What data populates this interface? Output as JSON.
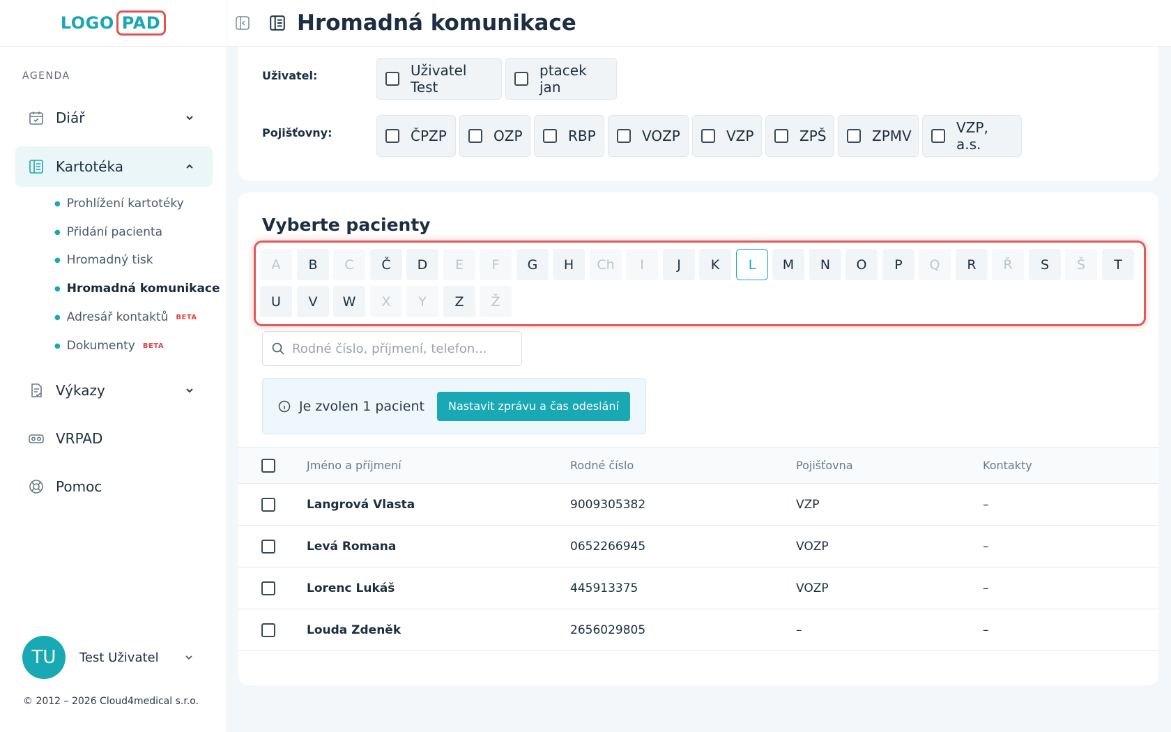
{
  "app": {
    "logo_left": "LOGO",
    "logo_right": "PAD",
    "page_title": "Hromadná komunikace"
  },
  "sidebar": {
    "section_label": "AGENDA",
    "nav": [
      {
        "label": "Diář"
      },
      {
        "label": "Kartotéka"
      },
      {
        "label": "Výkazy"
      },
      {
        "label": "VRPAD"
      },
      {
        "label": "Pomoc"
      }
    ],
    "sub_items": [
      {
        "label": "Prohlížení kartotéky"
      },
      {
        "label": "Přidání pacienta"
      },
      {
        "label": "Hromadný tisk"
      },
      {
        "label": "Hromadná komunikace"
      },
      {
        "label": "Adresář kontaktů",
        "badge": "BETA"
      },
      {
        "label": "Dokumenty",
        "badge": "BETA"
      }
    ],
    "user": {
      "initials": "TU",
      "name": "Test Uživatel"
    },
    "copyright": "© 2012 – 2026 Cloud4medical s.r.o."
  },
  "filters": {
    "users_label": "Uživatel:",
    "users": [
      "Uživatel Test",
      "ptacek jan"
    ],
    "insurers_label": "Pojišťovny:",
    "insurers": [
      "ČPZP",
      "OZP",
      "RBP",
      "VOZP",
      "VZP",
      "ZPŠ",
      "ZPMV",
      "VZP, a.s."
    ]
  },
  "patients": {
    "title": "Vyberte pacienty",
    "letters": [
      "A",
      "B",
      "C",
      "Č",
      "D",
      "E",
      "F",
      "G",
      "H",
      "Ch",
      "I",
      "J",
      "K",
      "L",
      "M",
      "N",
      "O",
      "P",
      "Q",
      "R",
      "Ř",
      "S",
      "Š",
      "T",
      "U",
      "V",
      "W",
      "X",
      "Y",
      "Z",
      "Ž"
    ],
    "search_placeholder": "Rodné číslo, příjmení, telefon...",
    "info_text": "Je zvolen 1 pacient",
    "action_button": "Nastavit zprávu a čas odeslání",
    "columns": [
      "Jméno a příjmení",
      "Rodné číslo",
      "Pojišťovna",
      "Kontakty"
    ],
    "rows": [
      {
        "name": "Langrová Vlasta",
        "rc": "9009305382",
        "insurer": "VZP",
        "contacts": "–"
      },
      {
        "name": "Levá Romana",
        "rc": "0652266945",
        "insurer": "VOZP",
        "contacts": "–"
      },
      {
        "name": "Lorenc Lukáš",
        "rc": "445913375",
        "insurer": "VOZP",
        "contacts": "–"
      },
      {
        "name": "Louda Zdeněk",
        "rc": "2656029805",
        "insurer": "–",
        "contacts": "–"
      }
    ]
  }
}
